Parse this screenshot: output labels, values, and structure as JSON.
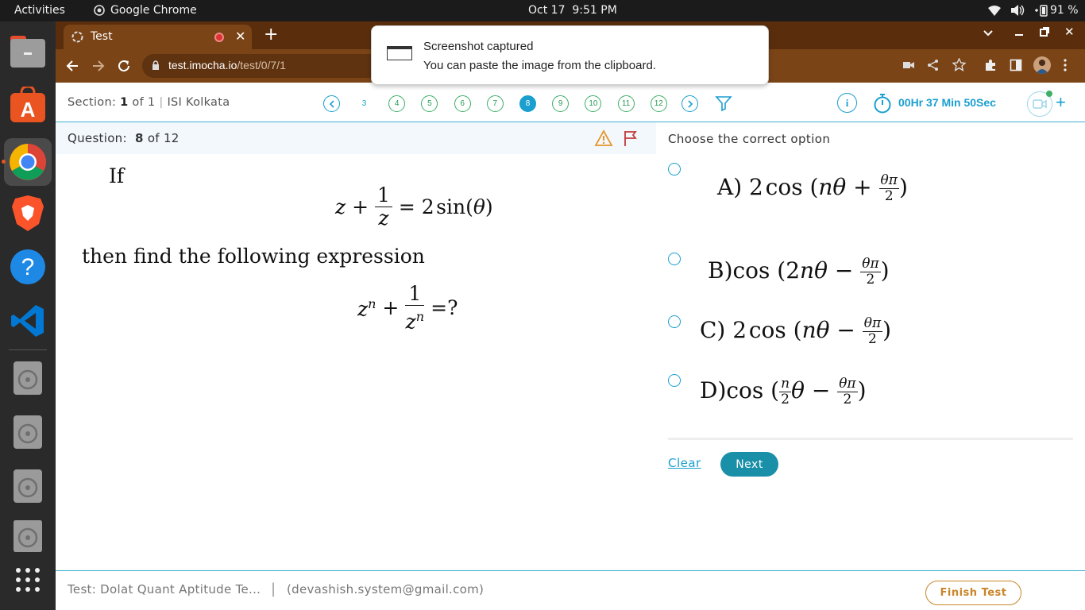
{
  "system_bar": {
    "activities": "Activities",
    "app_name": "Google Chrome",
    "date": "Oct 17",
    "time": "9:51 PM",
    "battery": "91 %"
  },
  "browser": {
    "tab_title": "Test",
    "url_domain": "test.imocha.io",
    "url_path": "/test/0/7/1"
  },
  "notification": {
    "title": "Screenshot captured",
    "body": "You can paste the image from the clipboard."
  },
  "header": {
    "section_label": "Section:",
    "section_current": "1",
    "section_of": "of 1",
    "section_sep": "|",
    "section_name": "ISI Kolkata",
    "question_numbers": [
      "3",
      "4",
      "5",
      "6",
      "7",
      "8",
      "9",
      "10",
      "11",
      "12"
    ],
    "current_question": "8",
    "timer": "00Hr 37 Min 50Sec"
  },
  "question": {
    "label": "Question:",
    "current": "8",
    "of_text": "of 12",
    "line1": "If",
    "line2": "then find the following expression"
  },
  "answer": {
    "prompt": "Choose the correct option",
    "clear": "Clear",
    "next": "Next"
  },
  "footer": {
    "test_name": "Test: Dolat Quant Aptitude Te...",
    "sep": "|",
    "email": "(devashish.system@gmail.com)",
    "finish": "Finish Test"
  },
  "colors": {
    "accent": "#1a9fcf",
    "answered": "#3eb067",
    "next_button": "#1a8fa8",
    "finish_border": "#c9862a"
  }
}
